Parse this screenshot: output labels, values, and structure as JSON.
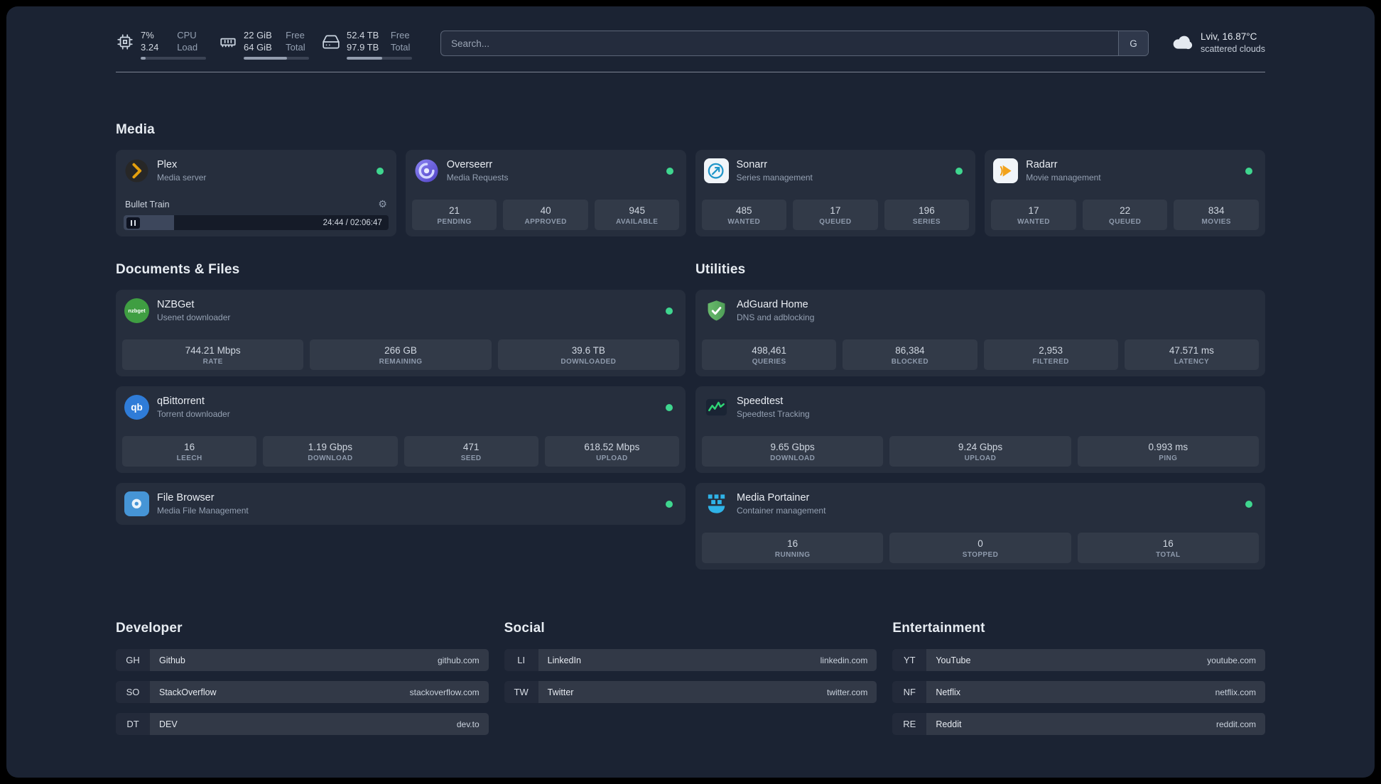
{
  "topbar": {
    "resources": [
      {
        "id": "cpu",
        "value_top": "7%",
        "value_bottom": "3.24",
        "label_top": "CPU",
        "label_bottom": "Load",
        "percent": 8
      },
      {
        "id": "memory",
        "value_top": "22 GiB",
        "value_bottom": "64 GiB",
        "label_top": "Free",
        "label_bottom": "Total",
        "percent": 66
      },
      {
        "id": "disk",
        "value_top": "52.4 TB",
        "value_bottom": "97.9 TB",
        "label_top": "Free",
        "label_bottom": "Total",
        "percent": 54
      }
    ],
    "search": {
      "placeholder": "Search...",
      "button_label": "G"
    },
    "weather": {
      "location": "Lviv, 16.87°C",
      "condition": "scattered clouds"
    }
  },
  "icons": {
    "gear": "⚙",
    "qbittorrent_glyph": "qb",
    "nzbget_glyph": "nzbget"
  },
  "sections": {
    "media": {
      "title": "Media",
      "plex": {
        "name": "Plex",
        "subtitle": "Media server",
        "now_playing": "Bullet Train",
        "time": "24:44 / 02:06:47",
        "progress_percent": 19
      },
      "overseerr": {
        "name": "Overseerr",
        "subtitle": "Media Requests",
        "stats": [
          {
            "value": "21",
            "label": "PENDING"
          },
          {
            "value": "40",
            "label": "APPROVED"
          },
          {
            "value": "945",
            "label": "AVAILABLE"
          }
        ]
      },
      "sonarr": {
        "name": "Sonarr",
        "subtitle": "Series management",
        "stats": [
          {
            "value": "485",
            "label": "WANTED"
          },
          {
            "value": "17",
            "label": "QUEUED"
          },
          {
            "value": "196",
            "label": "SERIES"
          }
        ]
      },
      "radarr": {
        "name": "Radarr",
        "subtitle": "Movie management",
        "stats": [
          {
            "value": "17",
            "label": "WANTED"
          },
          {
            "value": "22",
            "label": "QUEUED"
          },
          {
            "value": "834",
            "label": "MOVIES"
          }
        ]
      }
    },
    "documents": {
      "title": "Documents & Files",
      "nzbget": {
        "name": "NZBGet",
        "subtitle": "Usenet downloader",
        "stats": [
          {
            "value": "744.21 Mbps",
            "label": "RATE"
          },
          {
            "value": "266 GB",
            "label": "REMAINING"
          },
          {
            "value": "39.6 TB",
            "label": "DOWNLOADED"
          }
        ]
      },
      "qbittorrent": {
        "name": "qBittorrent",
        "subtitle": "Torrent downloader",
        "stats": [
          {
            "value": "16",
            "label": "LEECH"
          },
          {
            "value": "1.19 Gbps",
            "label": "DOWNLOAD"
          },
          {
            "value": "471",
            "label": "SEED"
          },
          {
            "value": "618.52 Mbps",
            "label": "UPLOAD"
          }
        ]
      },
      "filebrowser": {
        "name": "File Browser",
        "subtitle": "Media File Management"
      }
    },
    "utilities": {
      "title": "Utilities",
      "adguard": {
        "name": "AdGuard Home",
        "subtitle": "DNS and adblocking",
        "stats": [
          {
            "value": "498,461",
            "label": "QUERIES"
          },
          {
            "value": "86,384",
            "label": "BLOCKED"
          },
          {
            "value": "2,953",
            "label": "FILTERED"
          },
          {
            "value": "47.571 ms",
            "label": "LATENCY"
          }
        ]
      },
      "speedtest": {
        "name": "Speedtest",
        "subtitle": "Speedtest Tracking",
        "stats": [
          {
            "value": "9.65 Gbps",
            "label": "DOWNLOAD"
          },
          {
            "value": "9.24 Gbps",
            "label": "UPLOAD"
          },
          {
            "value": "0.993 ms",
            "label": "PING"
          }
        ]
      },
      "portainer": {
        "name": "Media Portainer",
        "subtitle": "Container management",
        "stats": [
          {
            "value": "16",
            "label": "RUNNING"
          },
          {
            "value": "0",
            "label": "STOPPED"
          },
          {
            "value": "16",
            "label": "TOTAL"
          }
        ]
      }
    }
  },
  "bookmarks": [
    {
      "title": "Developer",
      "items": [
        {
          "abbr": "GH",
          "name": "Github",
          "url": "github.com"
        },
        {
          "abbr": "SO",
          "name": "StackOverflow",
          "url": "stackoverflow.com"
        },
        {
          "abbr": "DT",
          "name": "DEV",
          "url": "dev.to"
        }
      ]
    },
    {
      "title": "Social",
      "items": [
        {
          "abbr": "LI",
          "name": "LinkedIn",
          "url": "linkedin.com"
        },
        {
          "abbr": "TW",
          "name": "Twitter",
          "url": "twitter.com"
        }
      ]
    },
    {
      "title": "Entertainment",
      "items": [
        {
          "abbr": "YT",
          "name": "YouTube",
          "url": "youtube.com"
        },
        {
          "abbr": "NF",
          "name": "Netflix",
          "url": "netflix.com"
        },
        {
          "abbr": "RE",
          "name": "Reddit",
          "url": "reddit.com"
        }
      ]
    }
  ]
}
